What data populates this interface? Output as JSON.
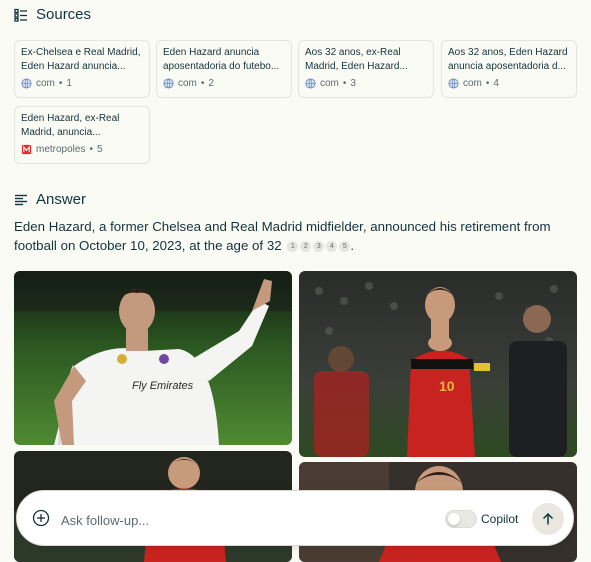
{
  "sources": {
    "heading": "Sources",
    "items": [
      {
        "title": "Ex-Chelsea e Real Madrid, Eden Hazard anuncia...",
        "domain": "com",
        "index": "1",
        "icon": "globe-icon"
      },
      {
        "title": "Eden Hazard anuncia aposentadoria do futebo...",
        "domain": "com",
        "index": "2",
        "icon": "globe-icon"
      },
      {
        "title": "Aos 32 anos, ex-Real Madrid, Eden Hazard...",
        "domain": "com",
        "index": "3",
        "icon": "globe-icon"
      },
      {
        "title": "Aos 32 anos, Eden Hazard anuncia aposentadoria d...",
        "domain": "com",
        "index": "4",
        "icon": "globe-icon"
      },
      {
        "title": "Eden Hazard, ex-Real Madrid, anuncia...",
        "domain": "metropoles",
        "index": "5",
        "icon": "metropoles-logo-icon"
      }
    ]
  },
  "answer": {
    "heading": "Answer",
    "text": "Eden Hazard, a former Chelsea and Real Madrid midfielder, announced his retirement from football on October 10, 2023, at the age of 32",
    "citations": [
      "1",
      "2",
      "3",
      "4",
      "5"
    ],
    "end_punct": "."
  },
  "photos": {
    "jersey_sponsor": "Fly Emirates",
    "jersey_number": "10"
  },
  "composer": {
    "placeholder": "Ask follow-up...",
    "copilot_label": "Copilot",
    "copilot_enabled": false
  },
  "colors": {
    "background": "#fbfbf6",
    "text": "#13343b",
    "muted": "#5f6b6e",
    "border": "#e4e4dc",
    "metropoles_red": "#e8262a"
  }
}
